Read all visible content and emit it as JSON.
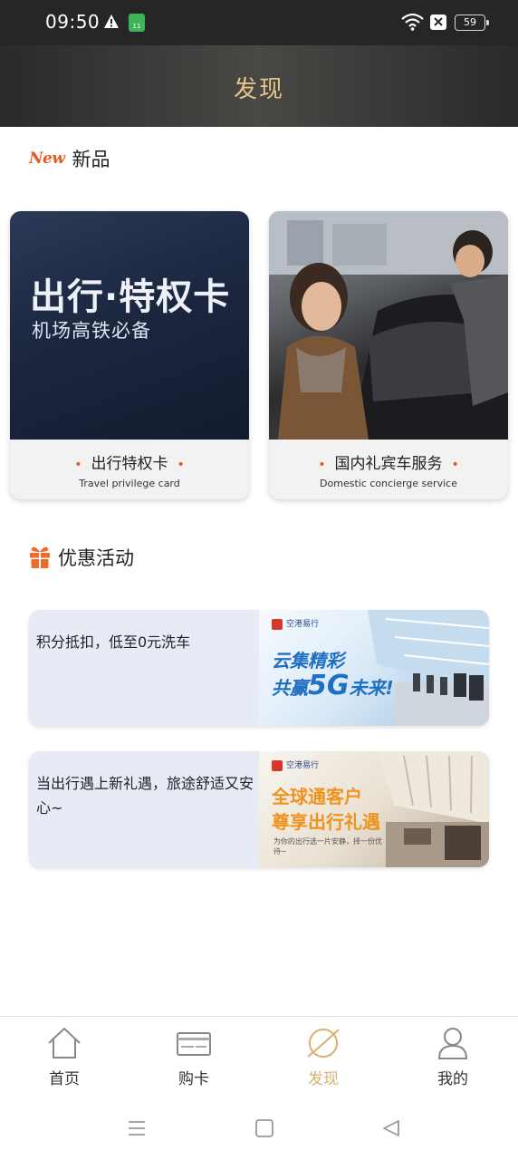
{
  "status_bar": {
    "time": "09:50",
    "sim_label": "11",
    "battery": "59"
  },
  "header": {
    "title": "发现"
  },
  "new_section": {
    "badge": "New",
    "title": "新品",
    "cards": [
      {
        "image_title": "出行·特权卡",
        "image_subtitle": "机场高铁必备",
        "label": "出行特权卡",
        "sublabel": "Travel privilege card"
      },
      {
        "label": "国内礼宾车服务",
        "sublabel": "Domestic concierge service"
      }
    ]
  },
  "promo_section": {
    "title": "优惠活动",
    "items": [
      {
        "text": "积分抵扣，低至0元洗车",
        "logo": "空港易行",
        "line1": "云集精彩",
        "line2_a": "共赢",
        "line2_b": "5G",
        "line2_c": "未来!"
      },
      {
        "text": "当出行遇上新礼遇，旅途舒适又安心~",
        "logo": "空港易行",
        "line1": "全球通客户",
        "line2": "尊享出行礼遇",
        "small": "为你的出行选一片安静，择一份优待~"
      }
    ]
  },
  "bottom_nav": {
    "items": [
      {
        "label": "首页",
        "icon": "home-icon"
      },
      {
        "label": "购卡",
        "icon": "card-icon"
      },
      {
        "label": "发现",
        "icon": "planet-icon",
        "active": true
      },
      {
        "label": "我的",
        "icon": "profile-icon"
      }
    ],
    "active_color": "#d6b271"
  }
}
